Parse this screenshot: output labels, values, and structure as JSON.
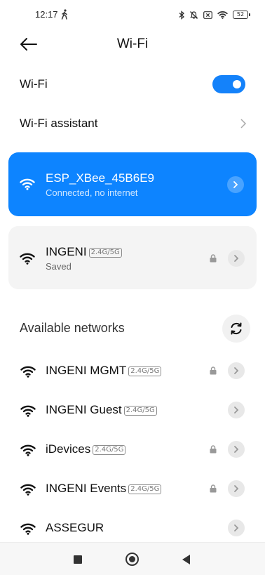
{
  "status_bar": {
    "time": "12:17",
    "battery": "52",
    "icons": [
      "walk-icon",
      "bluetooth-icon",
      "vibrate-off-icon",
      "no-sim-icon",
      "wifi-status-icon",
      "battery-icon"
    ]
  },
  "header": {
    "title": "Wi-Fi",
    "back_icon": "arrow-left-icon"
  },
  "wifi_toggle": {
    "label": "Wi-Fi",
    "on": true,
    "accent": "#1482fa"
  },
  "assistant": {
    "label": "Wi-Fi assistant"
  },
  "connected": {
    "name": "ESP_XBee_45B6E9",
    "status": "Connected, no internet",
    "color": "#0d84ff"
  },
  "saved": {
    "name": "INGENI",
    "band": "2.4G/5G",
    "status": "Saved",
    "secured": true
  },
  "available": {
    "title": "Available networks",
    "refresh_icon": "refresh-icon",
    "networks": [
      {
        "name": "INGENI MGMT",
        "band": "2.4G/5G",
        "secured": true
      },
      {
        "name": "INGENI Guest",
        "band": "2.4G/5G",
        "secured": false
      },
      {
        "name": "iDevices",
        "band": "2.4G/5G",
        "secured": true
      },
      {
        "name": "INGENI Events",
        "band": "2.4G/5G",
        "secured": true
      },
      {
        "name": "ASSEGUR",
        "band": "",
        "secured": false
      }
    ]
  },
  "nav": {
    "icons": [
      "recents-square-icon",
      "home-circle-icon",
      "back-triangle-icon"
    ]
  }
}
